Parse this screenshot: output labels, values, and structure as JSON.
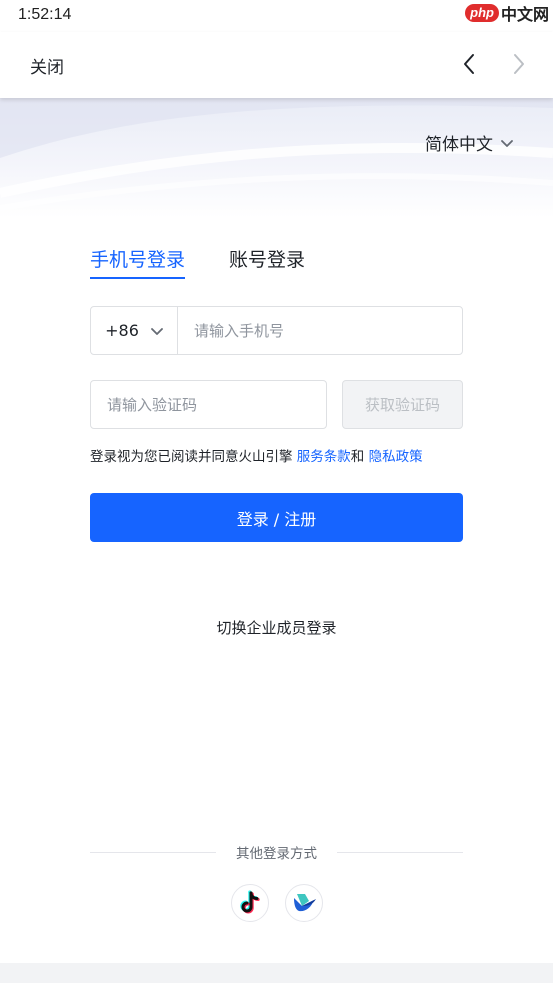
{
  "status_bar": {
    "time": "1:52:14"
  },
  "watermark": {
    "brand": "php",
    "site": "中文网"
  },
  "top_nav": {
    "close_label": "关闭"
  },
  "language": {
    "selected": "简体中文"
  },
  "tabs": [
    {
      "label": "手机号登录",
      "active": true
    },
    {
      "label": "账号登录",
      "active": false
    }
  ],
  "phone": {
    "country_code": "+86",
    "placeholder": "请输入手机号",
    "value": ""
  },
  "verification": {
    "placeholder": "请输入验证码",
    "value": "",
    "get_code_label": "获取验证码"
  },
  "agreement": {
    "prefix": "登录视为您已阅读并同意火山引擎 ",
    "terms_label": "服务条款",
    "joiner": "和 ",
    "privacy_label": "隐私政策"
  },
  "login_button": {
    "label": "登录 / 注册"
  },
  "switch_enterprise": {
    "label": "切换企业成员登录"
  },
  "other_login": {
    "label": "其他登录方式",
    "methods": [
      "tiktok-icon",
      "feishu-icon"
    ]
  },
  "colors": {
    "accent": "#1664ff",
    "disabled_bg": "#f2f3f5",
    "disabled_text": "#bbbfc4"
  }
}
